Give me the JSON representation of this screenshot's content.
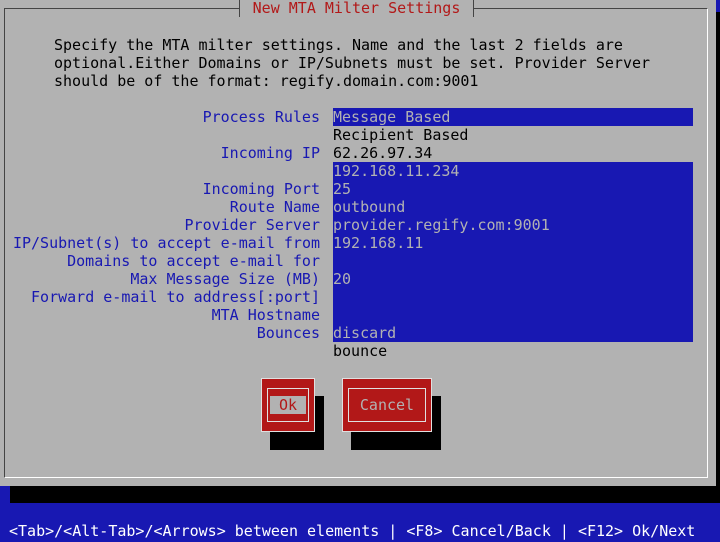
{
  "dialog": {
    "title": "New MTA Milter Settings",
    "description": "Specify the MTA milter settings. Name and the last 2 fields are\noptional.Either Domains or IP/Subnets must be set. Provider Server\nshould be of the format: regify.domain.com:9001"
  },
  "form": {
    "process_rules": {
      "label": "Process Rules",
      "options": [
        "Message Based",
        "Recipient Based"
      ],
      "selected": "Message Based"
    },
    "incoming_ip": {
      "label": "Incoming IP",
      "options": [
        "62.26.97.34",
        "192.168.11.234"
      ],
      "selected": "192.168.11.234"
    },
    "incoming_port": {
      "label": "Incoming Port",
      "value": "25"
    },
    "route_name": {
      "label": "Route Name",
      "value": "outbound"
    },
    "provider_server": {
      "label": "Provider Server",
      "value": "provider.regify.com:9001"
    },
    "ip_subnets": {
      "label": "IP/Subnet(s) to accept e-mail from",
      "value": "192.168.11"
    },
    "domains": {
      "label": "Domains to accept e-mail for",
      "value": ""
    },
    "max_message_size": {
      "label": "Max Message Size (MB)",
      "value": "20"
    },
    "forward_address": {
      "label": "Forward e-mail to address[:port]",
      "value": ""
    },
    "mta_hostname": {
      "label": "MTA Hostname",
      "value": ""
    },
    "bounces": {
      "label": "Bounces",
      "options": [
        "discard",
        "bounce"
      ],
      "selected": "discard"
    }
  },
  "buttons": {
    "ok": "Ok",
    "cancel": "Cancel"
  },
  "status_bar": "<Tab>/<Alt-Tab>/<Arrows> between elements | <F8> Cancel/Back | <F12> Ok/Next",
  "colors": {
    "background": "#1818b2",
    "panel": "#b2b2b2",
    "accent_red": "#b21818"
  }
}
